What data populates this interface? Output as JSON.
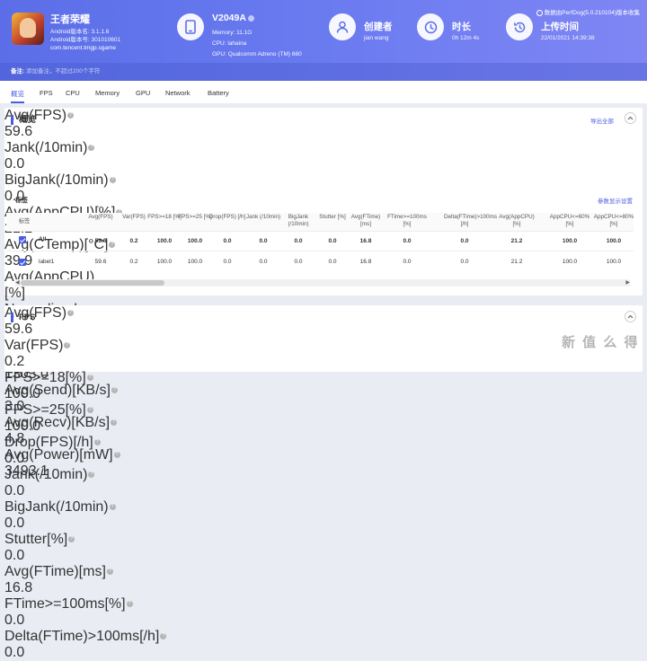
{
  "header": {
    "app_name": "王者荣耀",
    "android_version": "Android版本名: 3.1.1.6",
    "android_code": "Android版本号: 301010601",
    "package": "com.tencent.tmgp.sgame",
    "device": {
      "name": "V2049A",
      "memory": "Memory: 11.1G",
      "cpu": "CPU: lahaina",
      "gpu": "GPU: Qualcomm Adreno (TM) 660"
    },
    "creator": {
      "title": "创建者",
      "value": "jian wang"
    },
    "duration": {
      "title": "时长",
      "value": "0h 12m 4s"
    },
    "upload": {
      "title": "上传时间",
      "value": "22/01/2021 14:39:38"
    },
    "version_text": "数据由PerfDog(5.0.210104)版本收集",
    "note_label": "备注:",
    "note_placeholder": "添加备注，不超过200个字符"
  },
  "tabs": [
    "概览",
    "FPS",
    "CPU",
    "Memory",
    "GPU",
    "Network",
    "Battery"
  ],
  "overview": {
    "title": "概览",
    "export": "导出全部",
    "metrics": [
      {
        "label": "Avg(FPS)",
        "value": "59.6"
      },
      {
        "label": "Jank(/10min)",
        "value": "0.0"
      },
      {
        "label": "BigJank(/10min)",
        "value": "0.0"
      },
      {
        "label": "Avg(AppCPU)[%]",
        "value": "21.2"
      },
      {
        "label": "Avg(CTemp)[°C]",
        "value": "39.9"
      },
      {
        "label": "Avg(AppCPU)[%] Normalized",
        "value": "13.6"
      },
      {
        "label": "Peak(Memory)[MB]",
        "value": "1303.0"
      },
      {
        "label": "Avg(Send)[KB/s]",
        "value": "3.0"
      },
      {
        "label": "Avg(Recv)[KB/s]",
        "value": "4.8"
      },
      {
        "label": "Avg(Power)[mW]",
        "value": "3493.1"
      }
    ],
    "tags_title": "标签",
    "param_settings": "参数显示设置",
    "table": {
      "headers": [
        "标签",
        "Avg(FPS)",
        "Var(FPS)",
        "FPS>=18 [%]",
        "FPS>=25 [%]",
        "Drop(FPS) [/h]",
        "Jank (/10min)",
        "BigJank (/10min)",
        "Stutter [%]",
        "Avg(FTime) [ms]",
        "FTime>=100ms [%]",
        "Delta(FTime)>100ms [/h]",
        "Avg(AppCPU) [%]",
        "AppCPU<=60% [%]",
        "AppCPU<=80% [%]"
      ],
      "rows": [
        {
          "label": "All",
          "cells": [
            "59.6",
            "0.2",
            "100.0",
            "100.0",
            "0.0",
            "0.0",
            "0.0",
            "0.0",
            "16.8",
            "0.0",
            "0.0",
            "21.2",
            "100.0",
            "100.0"
          ]
        },
        {
          "label": "label1",
          "cells": [
            "59.6",
            "0.2",
            "100.0",
            "100.0",
            "0.0",
            "0.0",
            "0.0",
            "0.0",
            "16.8",
            "0.0",
            "0.0",
            "21.2",
            "100.0",
            "100.0"
          ]
        }
      ]
    }
  },
  "fps": {
    "title": "FPS",
    "metrics": [
      {
        "label": "Avg(FPS)",
        "value": "59.6"
      },
      {
        "label": "Var(FPS)",
        "value": "0.2"
      },
      {
        "label": "FPS>=18[%]",
        "value": "100.0"
      },
      {
        "label": "FPS>=25[%]",
        "value": "100.0"
      },
      {
        "label": "Drop(FPS)[/h]",
        "value": "0.0"
      },
      {
        "label": "Jank(/10min)",
        "value": "0.0"
      },
      {
        "label": "BigJank(/10min)",
        "value": "0.0"
      },
      {
        "label": "Stutter[%]",
        "value": "0.0"
      },
      {
        "label": "Avg(FTime)[ms]",
        "value": "16.8"
      },
      {
        "label": "FTime>=100ms[%]",
        "value": "0.0"
      },
      {
        "label": "Delta(FTime)>100ms[/h]",
        "value": "0.0"
      }
    ]
  },
  "watermark": "新 值 么 得",
  "colors": {
    "accent": "#4a5de0",
    "header_start": "#5b6ee8",
    "header_end": "#7f86f4"
  }
}
